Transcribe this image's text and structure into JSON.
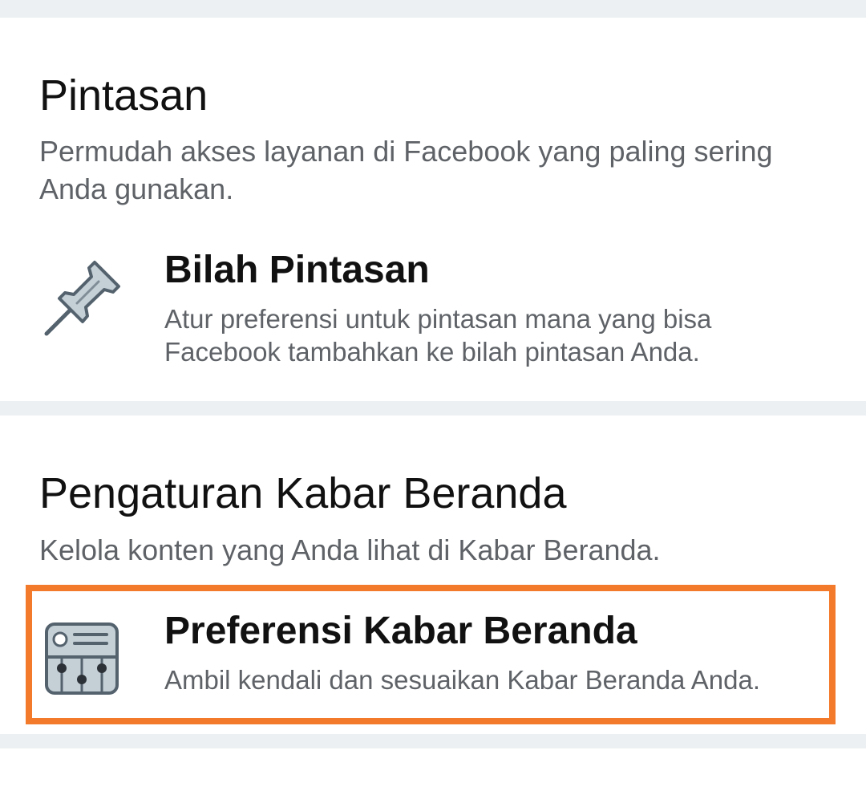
{
  "shortcuts": {
    "title": "Pintasan",
    "description": "Permudah akses layanan di Facebook yang paling sering Anda gunakan.",
    "items": [
      {
        "title": "Bilah Pintasan",
        "description": "Atur preferensi untuk pintasan mana yang bisa Facebook tambahkan ke bilah pintasan Anda.",
        "icon": "pushpin-icon"
      }
    ]
  },
  "news_feed": {
    "title": "Pengaturan Kabar Beranda",
    "description": "Kelola konten yang Anda lihat di Kabar Beranda.",
    "items": [
      {
        "title": "Preferensi Kabar Beranda",
        "description": "Ambil kendali dan sesuaikan Kabar Beranda Anda.",
        "icon": "news-feed-preferences-icon",
        "highlighted": true,
        "highlight_color": "#f47a2b"
      }
    ]
  },
  "colors": {
    "divider": "#ecf0f2",
    "title_text": "#111111",
    "secondary_text": "#5f6368",
    "highlight": "#f47a2b"
  }
}
